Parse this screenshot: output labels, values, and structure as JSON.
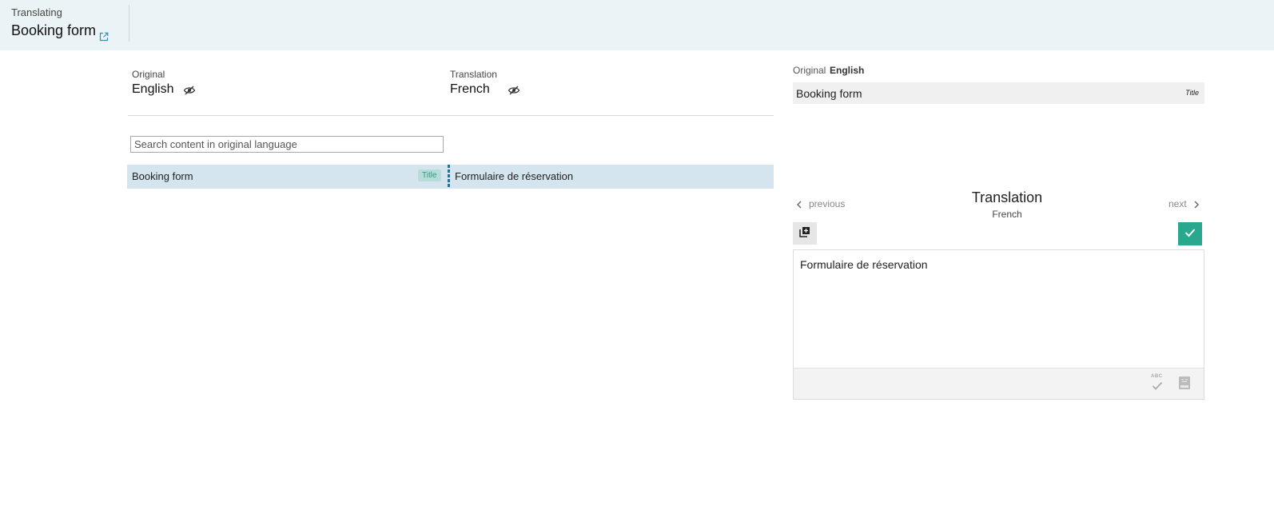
{
  "header": {
    "label": "Translating",
    "title": "Booking form"
  },
  "languages": {
    "original_label": "Original",
    "original_name": "English",
    "translation_label": "Translation",
    "translation_name": "French"
  },
  "search": {
    "placeholder": "Search content in original language",
    "value": ""
  },
  "rows": [
    {
      "original": "Booking form",
      "type": "Title",
      "translation": "Formulaire de réservation"
    }
  ],
  "right_panel": {
    "original_label": "Original",
    "original_lang": "English",
    "original_text": "Booking form",
    "original_tag": "Title",
    "previous_label": "previous",
    "next_label": "next",
    "translation_title": "Translation",
    "translation_lang": "French",
    "editor_text": "Formulaire de réservation",
    "spellcheck_label": "ABC"
  },
  "colors": {
    "header_bg": "#eaf3f6",
    "row_bg": "#d5e5ef",
    "accent_green": "#2aa88f",
    "badge_text": "#2f9a8a",
    "link_blue": "#3a8fb0"
  },
  "icons": {
    "external_link": "external-link-icon",
    "visibility": "eye-slash-icon",
    "copy": "copy-icon",
    "confirm": "check-icon",
    "prev": "chevron-left-icon",
    "next": "chevron-right-icon",
    "spellcheck": "spellcheck-icon",
    "dictionary": "dictionary-icon"
  }
}
